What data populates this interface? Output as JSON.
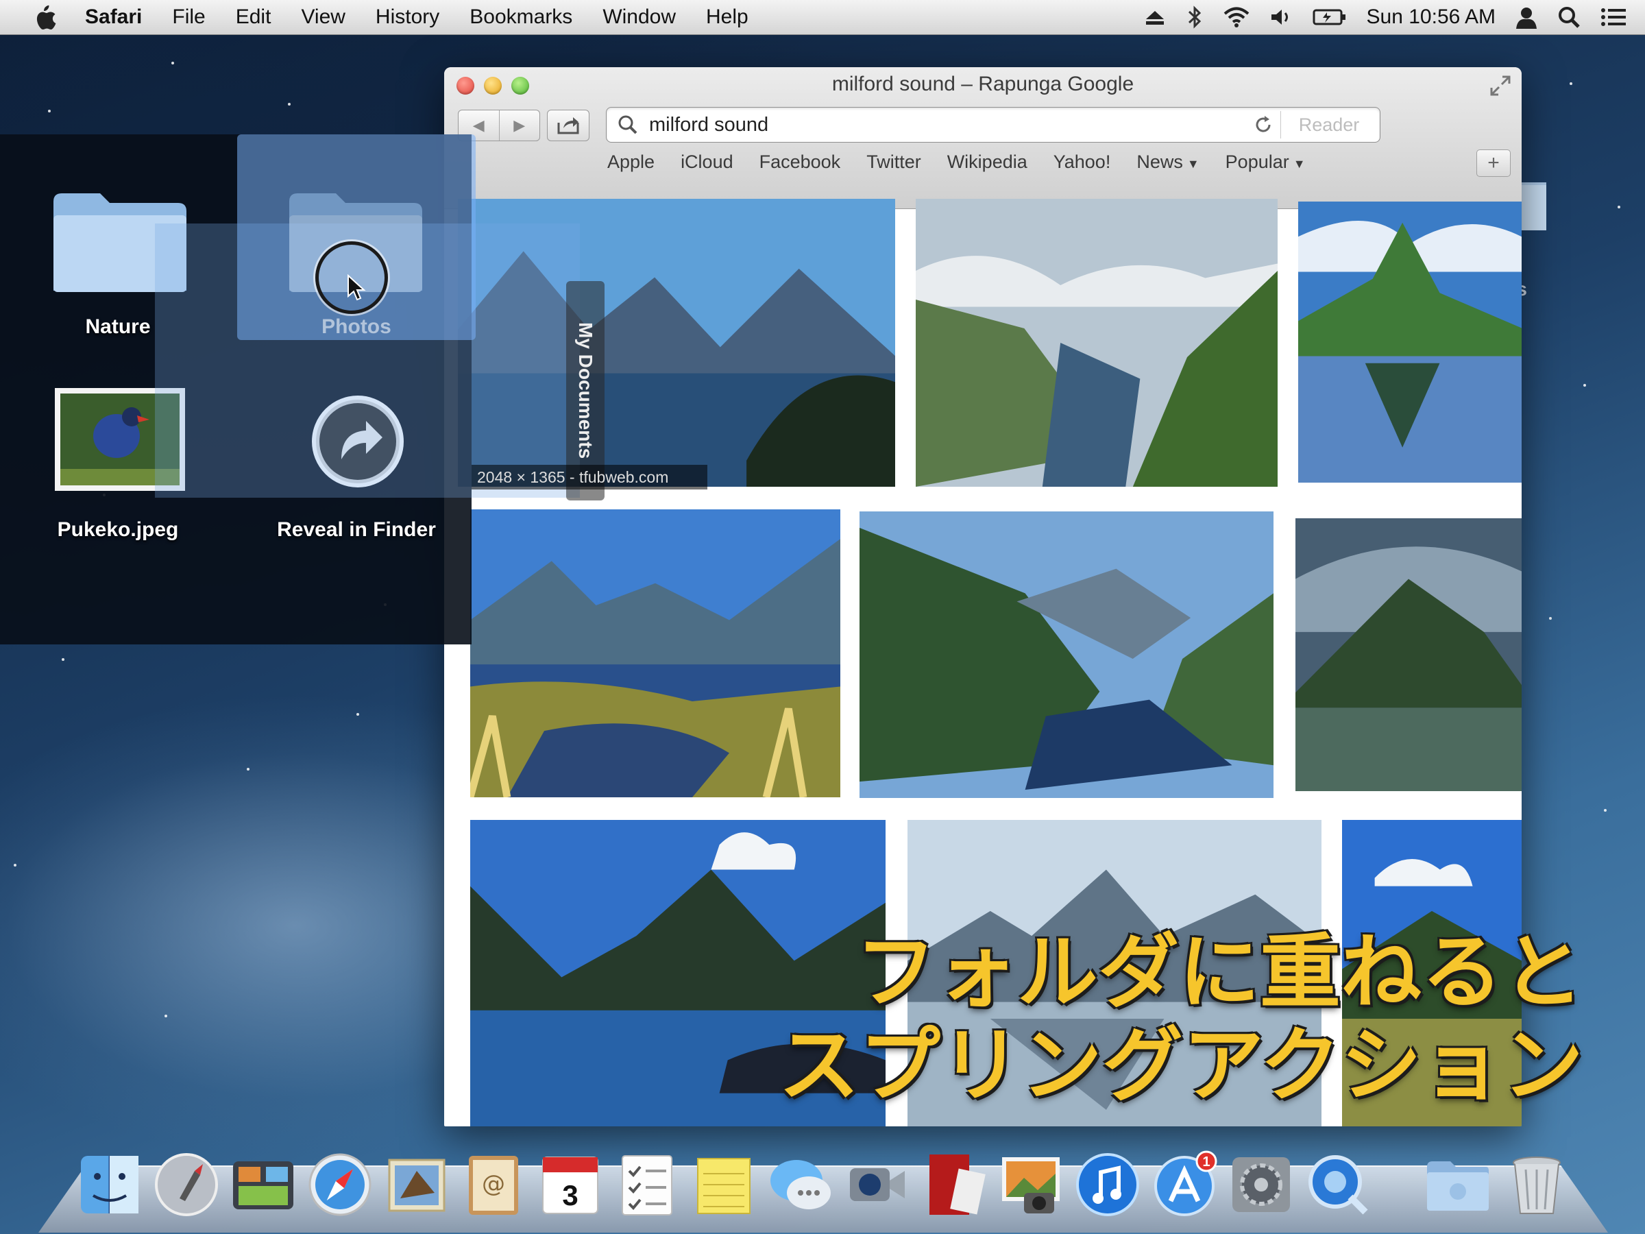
{
  "menubar": {
    "app": "Safari",
    "items": [
      "File",
      "Edit",
      "View",
      "History",
      "Bookmarks",
      "Window",
      "Help"
    ],
    "clock": "Sun 10:56 AM",
    "status_icons": [
      "eject-icon",
      "bluetooth-icon",
      "wifi-icon",
      "volume-icon",
      "battery-icon",
      "user-icon",
      "spotlight-icon",
      "notification-center-icon"
    ]
  },
  "window": {
    "title": "milford sound – Rapunga Google",
    "search_value": "milford sound",
    "reader": "Reader",
    "bookmarks": [
      "Apple",
      "iCloud",
      "Facebook",
      "Twitter",
      "Wikipedia",
      "Yahoo!",
      "News",
      "Popular"
    ],
    "image_info": "2048 × 1365 - tfubweb.com"
  },
  "stack": {
    "items": [
      "Nature",
      "Photos",
      "Pukeko.jpeg",
      "Reveal in Finder"
    ],
    "drop_target_tab": "My Documents"
  },
  "desktop": {
    "peek_label": "nts"
  },
  "caption": {
    "line1": "フォルダに重ねると",
    "line2": "スプリングアクション"
  },
  "dock": {
    "items": [
      "finder-icon",
      "launchpad-icon",
      "mission-control-icon",
      "safari-icon",
      "mail-icon",
      "contacts-icon",
      "calendar-icon",
      "reminders-icon",
      "notes-icon",
      "messages-icon",
      "facetime-icon",
      "photo-booth-icon",
      "iphoto-icon",
      "itunes-icon",
      "app-store-icon",
      "system-preferences-icon",
      "quicktime-icon",
      "documents-folder-icon",
      "trash-icon"
    ],
    "calendar_day": "3",
    "app_store_badge": "1"
  }
}
